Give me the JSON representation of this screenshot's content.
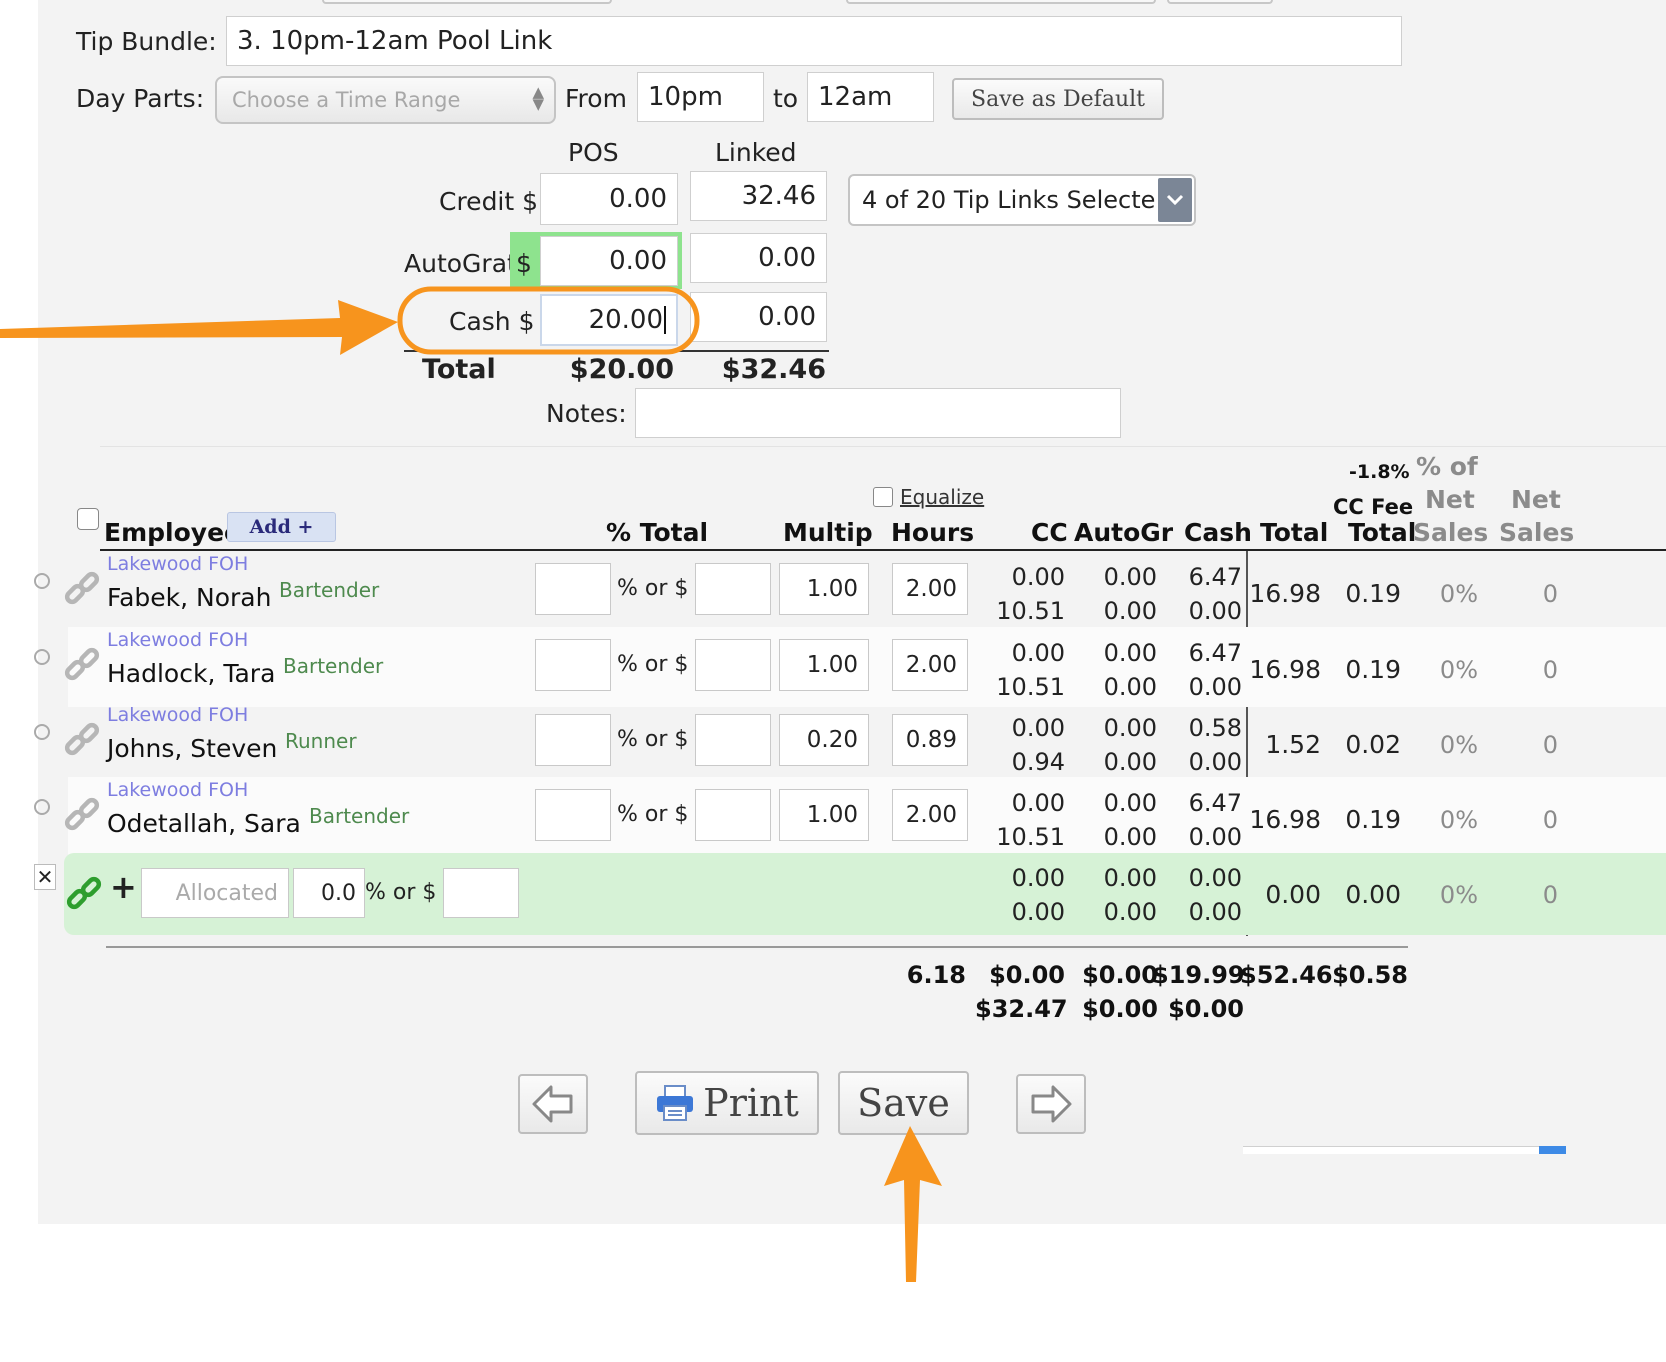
{
  "form": {
    "tip_bundle_label": "Tip Bundle:",
    "tip_bundle_value": "3.  10pm-12am Pool Link",
    "day_parts_label": "Day Parts:",
    "day_parts_placeholder": "Choose a Time Range",
    "from_label": "From",
    "from_value": "10pm",
    "to_label": "to",
    "to_value": "12am",
    "save_default_label": "Save as Default"
  },
  "tips": {
    "col_pos": "POS",
    "col_linked": "Linked",
    "credit_label": "Credit $",
    "credit_pos": "0.00",
    "credit_linked": "32.46",
    "autograt_label": "AutoGrat",
    "autograt_dollar": "$",
    "autograt_pos": "0.00",
    "autograt_linked": "0.00",
    "cash_label": "Cash $",
    "cash_pos": "20.00",
    "cash_linked": "0.00",
    "total_label": "Total",
    "total_pos": "$20.00",
    "total_linked": "$32.46",
    "tip_links_select": "4 of 20 Tip Links Selecte",
    "notes_label": "Notes:"
  },
  "table": {
    "equalize_label": "Equalize",
    "cc_fee_pct": "-1.8%",
    "headers": {
      "employee": "Employee",
      "add_button": "Add +",
      "pct_total": "% Total",
      "multip": "Multip",
      "hours": "Hours",
      "cc": "CC",
      "autogr": "AutoGr",
      "cash": "Cash",
      "total": "Total",
      "cc_fee_total_1": "CC Fee",
      "cc_fee_total_2": "Total",
      "pct_net_sales_1": "% of",
      "pct_net_sales_2": "Net",
      "pct_net_sales_3": "Sales",
      "net_sales_1": "Net",
      "net_sales_2": "Sales"
    },
    "rows": [
      {
        "location": "Lakewood FOH",
        "name": "Fabek, Norah",
        "role": "Bartender",
        "pct_or": "% or $",
        "multip": "1.00",
        "hours": "2.00",
        "cc_top": "0.00",
        "cc_bottom": "10.51",
        "autogr_top": "0.00",
        "autogr_bottom": "0.00",
        "cash_top": "6.47",
        "cash_bottom": "0.00",
        "total": "16.98",
        "cc_fee": "0.19",
        "pct_net": "0%",
        "net_sales": "0"
      },
      {
        "location": "Lakewood FOH",
        "name": "Hadlock, Tara",
        "role": "Bartender",
        "pct_or": "% or $",
        "multip": "1.00",
        "hours": "2.00",
        "cc_top": "0.00",
        "cc_bottom": "10.51",
        "autogr_top": "0.00",
        "autogr_bottom": "0.00",
        "cash_top": "6.47",
        "cash_bottom": "0.00",
        "total": "16.98",
        "cc_fee": "0.19",
        "pct_net": "0%",
        "net_sales": "0"
      },
      {
        "location": "Lakewood FOH",
        "name": "Johns, Steven",
        "role": "Runner",
        "pct_or": "% or $",
        "multip": "0.20",
        "hours": "0.89",
        "cc_top": "0.00",
        "cc_bottom": "0.94",
        "autogr_top": "0.00",
        "autogr_bottom": "0.00",
        "cash_top": "0.58",
        "cash_bottom": "0.00",
        "total": "1.52",
        "cc_fee": "0.02",
        "pct_net": "0%",
        "net_sales": "0"
      },
      {
        "location": "Lakewood FOH",
        "name": "Odetallah, Sara",
        "role": "Bartender",
        "pct_or": "% or $",
        "multip": "1.00",
        "hours": "2.00",
        "cc_top": "0.00",
        "cc_bottom": "10.51",
        "autogr_top": "0.00",
        "autogr_bottom": "0.00",
        "cash_top": "6.47",
        "cash_bottom": "0.00",
        "total": "16.98",
        "cc_fee": "0.19",
        "pct_net": "0%",
        "net_sales": "0"
      }
    ],
    "allocated": {
      "plus": "+",
      "placeholder": "Allocated",
      "pct_value": "0.0",
      "pct_or": "% or $",
      "cc_top": "0.00",
      "cc_bottom": "0.00",
      "autogr_top": "0.00",
      "autogr_bottom": "0.00",
      "cash_top": "0.00",
      "cash_bottom": "0.00",
      "total": "0.00",
      "cc_fee": "0.00",
      "pct_net": "0%",
      "net_sales": "0"
    },
    "totals": {
      "hours": "6.18",
      "cc_top": "$0.00",
      "cc_bottom": "$32.47",
      "autogr_top": "$0.00",
      "autogr_bottom": "$0.00",
      "cash_top": "$19.99",
      "cash_bottom": "$0.00",
      "total": "$52.46",
      "cc_fee": "$0.58"
    }
  },
  "footer": {
    "print_label": "Print",
    "save_label": "Save"
  },
  "colors": {
    "accent_arrow": "#f7941d",
    "allocated_row_bg": "#d6f2d6",
    "autograt_highlight": "#8ee38e",
    "link_active": "#2e9e2e"
  }
}
